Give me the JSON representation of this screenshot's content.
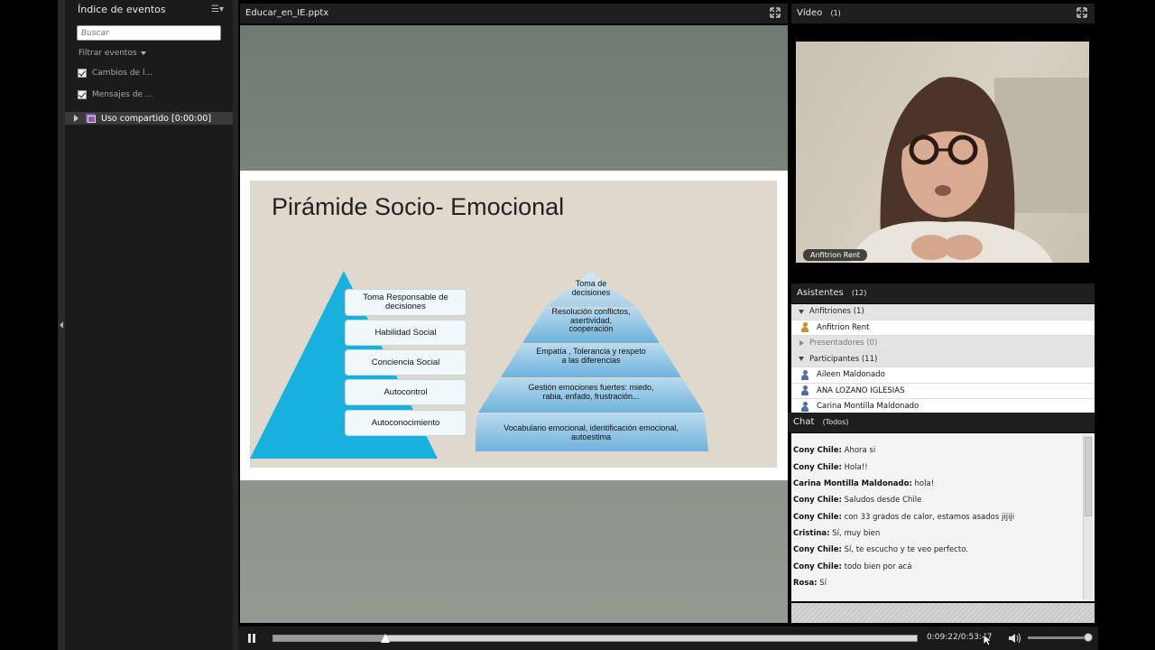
{
  "sidebar": {
    "title": "Índice de eventos",
    "search_placeholder": "Buscar",
    "filter_label": "Filtrar eventos",
    "checkboxes": [
      {
        "label": "Cambios de l...",
        "checked": true
      },
      {
        "label": "Mensajes de ...",
        "checked": true
      }
    ],
    "event_item": "Uso compartido [0:00:00]"
  },
  "presentation": {
    "title": "Educar_en_IE.pptx",
    "slide": {
      "title": "Pirámide Socio- Emocional",
      "left_levels": [
        "Toma Responsable de decisiones",
        "Habilidad Social",
        "Conciencia Social",
        "Autocontrol",
        "Autoconocimiento"
      ],
      "right_levels": [
        "Toma de decisiones",
        "Resolución conflictos, asertividad, cooperación",
        "Empatía , Tolerancia y respeto a las diferencias",
        "Gestión emociones fuertes: miedo, rabia, enfado, frustración...",
        "Vocabulario emocional, identificación emocional, autoestima"
      ]
    }
  },
  "video": {
    "title": "Vídeo",
    "count": "(1)",
    "name_tag": "Anfitrion Rent"
  },
  "attendees": {
    "title": "Asistentes",
    "count": "(12)",
    "groups": {
      "hosts": "Anfitriones (1)",
      "presenters": "Presentadores (0)",
      "participants": "Participantes (11)"
    },
    "host_names": [
      "Anfitrion Rent"
    ],
    "participant_names": [
      "Aileen Maldonado",
      "ANA LOZANO IGLESIAS",
      "Carina Montilla Maldonado"
    ]
  },
  "chat": {
    "title": "Chat",
    "scope": "(Todos)",
    "messages": [
      {
        "sender": "Cony Chile:",
        "text": "Ahora si"
      },
      {
        "sender": "Cony Chile:",
        "text": "Hola!!"
      },
      {
        "sender": "Carina Montilla Maldonado:",
        "text": "hola!"
      },
      {
        "sender": "Cony Chile:",
        "text": "Saludos desde Chile"
      },
      {
        "sender": "Cony Chile:",
        "text": "con 33 grados de calor, estamos asados jijiji"
      },
      {
        "sender": "Cristina:",
        "text": "Sí, muy bien"
      },
      {
        "sender": "Cony Chile:",
        "text": "Sí, te escucho y te veo perfecto."
      },
      {
        "sender": "Cony Chile:",
        "text": "todo bien por acá"
      },
      {
        "sender": "Rosa:",
        "text": "Sí"
      }
    ]
  },
  "playback": {
    "time": "0:09:22/0:53:47",
    "progress_fraction": 0.174
  }
}
